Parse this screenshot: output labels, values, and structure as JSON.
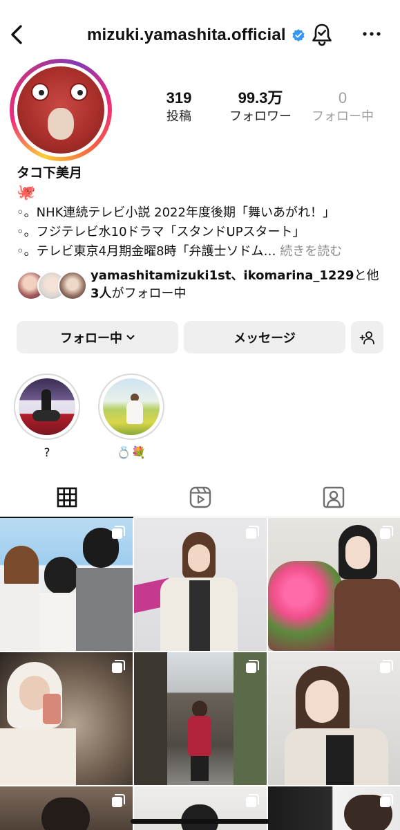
{
  "header": {
    "username": "mizuki.yamashita.official",
    "back_icon": "chevron-left-icon",
    "verified_icon": "verified-badge-icon",
    "bell_icon": "notification-bell-icon",
    "more_icon": "more-horizontal-icon"
  },
  "stats": {
    "posts_value": "319",
    "posts_label": "投稿",
    "followers_value": "99.3万",
    "followers_label": "フォロワー",
    "following_value": "0",
    "following_label": "フォロー中"
  },
  "bio": {
    "name": "タコ下美月",
    "emoji": "🐙",
    "line1": "◦。NHK連続テレビ小説 2022年度後期「舞いあがれ！」",
    "line2": "◦。フジテレビ水10ドラマ「スタンドUPスタート」",
    "line3": "◦。テレビ東京4月期金曜8時「弁護士ソドム…",
    "more": "続きを読む"
  },
  "mutuals": {
    "accounts": "yamashitamizuki1st、ikomarina_1229",
    "suffix": "と他",
    "count_line_bold": "3人",
    "count_line_rest": "がフォロー中"
  },
  "actions": {
    "following_label": "フォロー中",
    "message_label": "メッセージ",
    "add_person_icon": "add-person-icon"
  },
  "highlights": [
    {
      "label": "?"
    },
    {
      "label": "💍💐"
    }
  ],
  "tabs": {
    "grid_icon": "grid-icon",
    "reels_icon": "reels-icon",
    "tagged_icon": "tagged-person-icon"
  },
  "colors": {
    "accent_blue": "#3897f0",
    "button_bg": "#efefef",
    "muted_text": "#9e9e9e"
  }
}
